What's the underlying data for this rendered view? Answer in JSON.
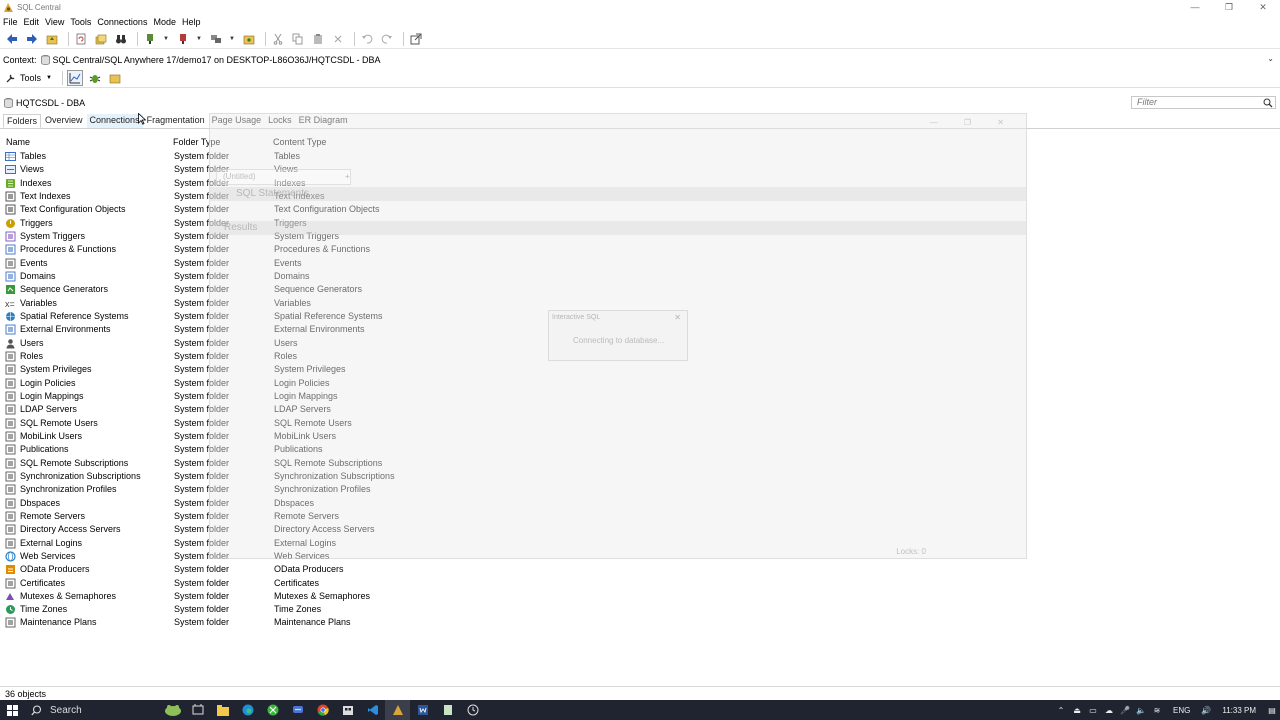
{
  "window": {
    "title": "SQL Central",
    "controls": [
      "—",
      "❐",
      "✕"
    ]
  },
  "menu": [
    "File",
    "Edit",
    "View",
    "Tools",
    "Connections",
    "Mode",
    "Help"
  ],
  "context": {
    "label": "Context:",
    "value": "SQL Central/SQL Anywhere 17/demo17 on DESKTOP-L86O36J/HQTCSDL - DBA"
  },
  "tools_button": {
    "label": "Tools"
  },
  "path": {
    "label": "HQTCSDL - DBA"
  },
  "filter": {
    "placeholder": "Filter"
  },
  "tabs": [
    {
      "label": "Folders",
      "active": true
    },
    {
      "label": "Overview",
      "active": false
    },
    {
      "label": "Connections",
      "active": false
    },
    {
      "label": "Fragmentation",
      "active": false
    },
    {
      "label": "Page Usage",
      "active": false
    },
    {
      "label": "Locks",
      "active": false
    },
    {
      "label": "ER Diagram",
      "active": false
    }
  ],
  "columns": {
    "name": "Name",
    "folder_type": "Folder Type",
    "content_type": "Content Type"
  },
  "rows": [
    {
      "name": "Tables",
      "folder_type": "System folder",
      "content_type": "Tables",
      "icon": "table-icon",
      "color": "#3a6fc4"
    },
    {
      "name": "Views",
      "folder_type": "System folder",
      "content_type": "Views",
      "icon": "view-icon",
      "color": "#3a6fc4"
    },
    {
      "name": "Indexes",
      "folder_type": "System folder",
      "content_type": "Indexes",
      "icon": "index-icon",
      "color": "#6aa92a"
    },
    {
      "name": "Text Indexes",
      "folder_type": "System folder",
      "content_type": "Text Indexes",
      "icon": "text-index-icon",
      "color": "#444"
    },
    {
      "name": "Text Configuration Objects",
      "folder_type": "System folder",
      "content_type": "Text Configuration Objects",
      "icon": "text-config-icon",
      "color": "#444"
    },
    {
      "name": "Triggers",
      "folder_type": "System folder",
      "content_type": "Triggers",
      "icon": "trigger-icon",
      "color": "#c9a000"
    },
    {
      "name": "System Triggers",
      "folder_type": "System folder",
      "content_type": "System Triggers",
      "icon": "system-trigger-icon",
      "color": "#7a4fb8"
    },
    {
      "name": "Procedures & Functions",
      "folder_type": "System folder",
      "content_type": "Procedures & Functions",
      "icon": "procedure-icon",
      "color": "#3a6fc4"
    },
    {
      "name": "Events",
      "folder_type": "System folder",
      "content_type": "Events",
      "icon": "event-icon",
      "color": "#555"
    },
    {
      "name": "Domains",
      "folder_type": "System folder",
      "content_type": "Domains",
      "icon": "domain-icon",
      "color": "#3a6fc4"
    },
    {
      "name": "Sequence Generators",
      "folder_type": "System folder",
      "content_type": "Sequence Generators",
      "icon": "sequence-icon",
      "color": "#3a9a3a"
    },
    {
      "name": "Variables",
      "folder_type": "System folder",
      "content_type": "Variables",
      "icon": "variable-icon",
      "color": "#444"
    },
    {
      "name": "Spatial Reference Systems",
      "folder_type": "System folder",
      "content_type": "Spatial Reference Systems",
      "icon": "globe-icon",
      "color": "#2a7fc4"
    },
    {
      "name": "External Environments",
      "folder_type": "System folder",
      "content_type": "External Environments",
      "icon": "external-env-icon",
      "color": "#3a6fc4"
    },
    {
      "name": "Users",
      "folder_type": "System folder",
      "content_type": "Users",
      "icon": "user-icon",
      "color": "#555"
    },
    {
      "name": "Roles",
      "folder_type": "System folder",
      "content_type": "Roles",
      "icon": "role-icon",
      "color": "#555"
    },
    {
      "name": "System Privileges",
      "folder_type": "System folder",
      "content_type": "System Privileges",
      "icon": "privilege-icon",
      "color": "#555"
    },
    {
      "name": "Login Policies",
      "folder_type": "System folder",
      "content_type": "Login Policies",
      "icon": "login-policy-icon",
      "color": "#555"
    },
    {
      "name": "Login Mappings",
      "folder_type": "System folder",
      "content_type": "Login Mappings",
      "icon": "login-mapping-icon",
      "color": "#555"
    },
    {
      "name": "LDAP Servers",
      "folder_type": "System folder",
      "content_type": "LDAP Servers",
      "icon": "ldap-icon",
      "color": "#555"
    },
    {
      "name": "SQL Remote Users",
      "folder_type": "System folder",
      "content_type": "SQL Remote Users",
      "icon": "remote-user-icon",
      "color": "#555"
    },
    {
      "name": "MobiLink Users",
      "folder_type": "System folder",
      "content_type": "MobiLink Users",
      "icon": "mobilink-user-icon",
      "color": "#555"
    },
    {
      "name": "Publications",
      "folder_type": "System folder",
      "content_type": "Publications",
      "icon": "publication-icon",
      "color": "#555"
    },
    {
      "name": "SQL Remote Subscriptions",
      "folder_type": "System folder",
      "content_type": "SQL Remote Subscriptions",
      "icon": "subscription-icon",
      "color": "#555"
    },
    {
      "name": "Synchronization Subscriptions",
      "folder_type": "System folder",
      "content_type": "Synchronization Subscriptions",
      "icon": "sync-subscription-icon",
      "color": "#555"
    },
    {
      "name": "Synchronization Profiles",
      "folder_type": "System folder",
      "content_type": "Synchronization Profiles",
      "icon": "sync-profile-icon",
      "color": "#555"
    },
    {
      "name": "Dbspaces",
      "folder_type": "System folder",
      "content_type": "Dbspaces",
      "icon": "dbspace-icon",
      "color": "#555"
    },
    {
      "name": "Remote Servers",
      "folder_type": "System folder",
      "content_type": "Remote Servers",
      "icon": "remote-server-icon",
      "color": "#555"
    },
    {
      "name": "Directory Access Servers",
      "folder_type": "System folder",
      "content_type": "Directory Access Servers",
      "icon": "directory-server-icon",
      "color": "#555"
    },
    {
      "name": "External Logins",
      "folder_type": "System folder",
      "content_type": "External Logins",
      "icon": "external-login-icon",
      "color": "#555"
    },
    {
      "name": "Web Services",
      "folder_type": "System folder",
      "content_type": "Web Services",
      "icon": "web-service-icon",
      "color": "#2a7fc4"
    },
    {
      "name": "OData Producers",
      "folder_type": "System folder",
      "content_type": "OData Producers",
      "icon": "odata-icon",
      "color": "#e08a00"
    },
    {
      "name": "Certificates",
      "folder_type": "System folder",
      "content_type": "Certificates",
      "icon": "certificate-icon",
      "color": "#555"
    },
    {
      "name": "Mutexes & Semaphores",
      "folder_type": "System folder",
      "content_type": "Mutexes & Semaphores",
      "icon": "mutex-icon",
      "color": "#7a4fb8"
    },
    {
      "name": "Time Zones",
      "folder_type": "System folder",
      "content_type": "Time Zones",
      "icon": "timezone-icon",
      "color": "#2a9a5a"
    },
    {
      "name": "Maintenance Plans",
      "folder_type": "System folder",
      "content_type": "Maintenance Plans",
      "icon": "maintenance-icon",
      "color": "#555"
    }
  ],
  "ghost_window": {
    "tab_label": "(Untitled)",
    "statements_label": "SQL Statements",
    "results_label": "Results",
    "locks_label": "Locks: 0"
  },
  "dialog": {
    "title": "Interactive SQL",
    "message": "Connecting to database..."
  },
  "status": {
    "text": "36 objects"
  },
  "taskbar": {
    "search_label": "Search",
    "language": "ENG",
    "time": "11:33 PM"
  }
}
